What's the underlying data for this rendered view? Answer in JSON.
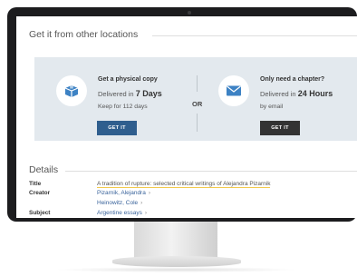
{
  "other_locations": {
    "title": "Get it from other locations",
    "physical": {
      "title": "Get a physical copy",
      "delivered_prefix": "Delivered in",
      "delivered_value": "7 Days",
      "keep": "Keep for 112 days",
      "button": "GET IT",
      "button_color": "#2f5e8e"
    },
    "or_label": "OR",
    "chapter": {
      "title": "Only need a chapter?",
      "delivered_prefix": "Delivered in",
      "delivered_value": "24 Hours",
      "method": "by email",
      "button": "GET IT",
      "button_color": "#333333"
    }
  },
  "details": {
    "title": "Details",
    "title_label": "Title",
    "title_value": "A tradition of rupture: selected critical writings of Alejandra Pizarnik",
    "creator_label": "Creator",
    "creators": [
      "Pizarnik, Alejandra",
      "Heinowitz, Cole"
    ],
    "subject_label": "Subject",
    "subject_value": "Argentine essays"
  },
  "icons": {
    "physical": "package-box-icon",
    "chapter": "envelope-icon",
    "link": "chevron-right-icon"
  }
}
